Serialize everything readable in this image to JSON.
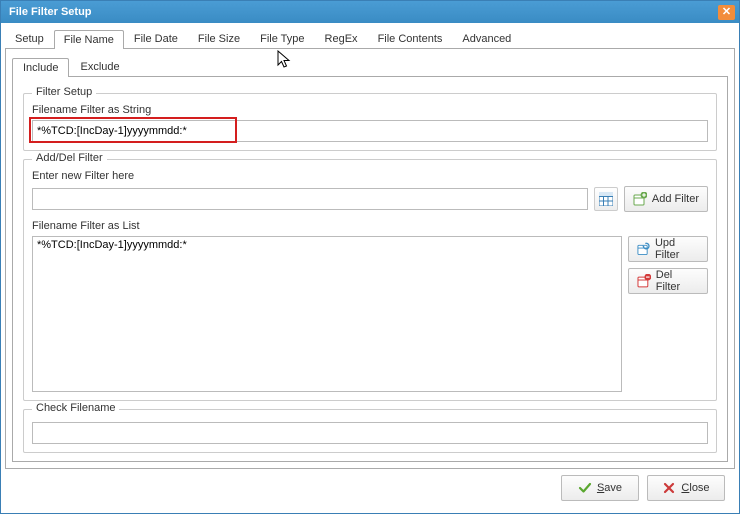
{
  "window": {
    "title": "File Filter Setup"
  },
  "tabs": {
    "main": [
      "Setup",
      "File Name",
      "File Date",
      "File Size",
      "File Type",
      "RegEx",
      "File Contents",
      "Advanced"
    ],
    "sub": [
      "Include",
      "Exclude"
    ]
  },
  "groups": {
    "filter_setup": "Filter Setup",
    "add_del_filter": "Add/Del Filter",
    "check_filename": "Check Filename"
  },
  "labels": {
    "filter_as_string": "Filename Filter as String",
    "enter_new_filter": "Enter new Filter here",
    "filter_as_list": "Filename Filter as List"
  },
  "values": {
    "filter_string": "*%TCD:[IncDay-1]yyyymmdd:*",
    "filter_list": [
      "*%TCD:[IncDay-1]yyyymmdd:*"
    ]
  },
  "buttons": {
    "add_filter": "Add Filter",
    "upd_filter": "Upd Filter",
    "del_filter": "Del Filter",
    "save": "Save",
    "close": "Close"
  }
}
